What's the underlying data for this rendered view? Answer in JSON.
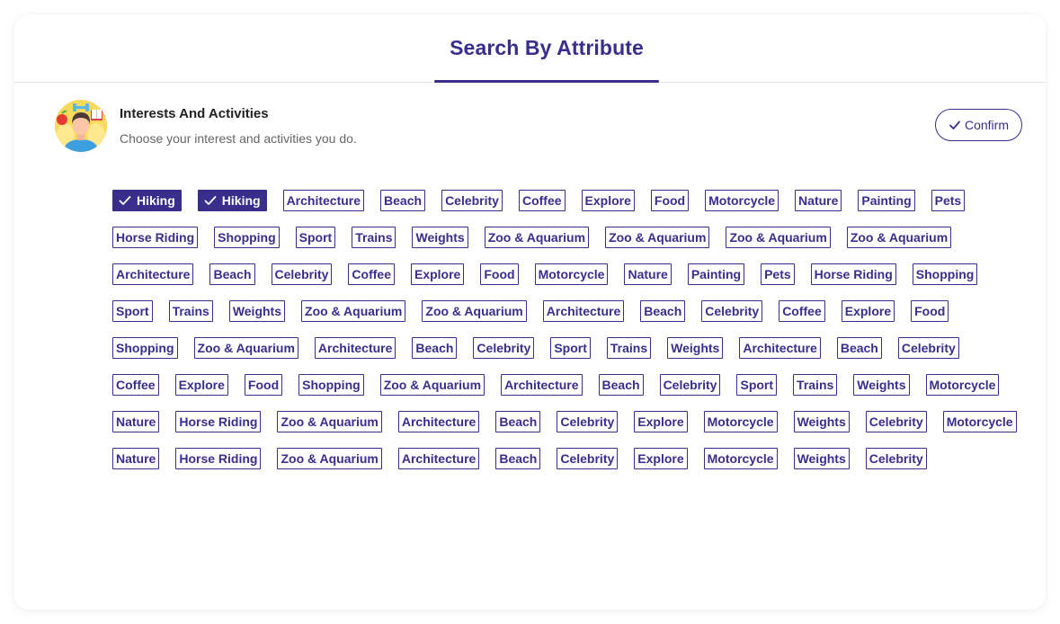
{
  "header": {
    "active_tab": "Search By Attribute"
  },
  "section": {
    "title": "Interests And Activities",
    "subtitle": "Choose your interest and activities you do.",
    "avatar_icon": "person-with-interests-icon",
    "confirm_label": "Confirm",
    "confirm_icon": "check-icon"
  },
  "colors": {
    "accent": "#3a2e8c",
    "text_dark": "#222222",
    "text_muted": "#666666",
    "divider": "#e3e3e8"
  },
  "chips": [
    {
      "label": "Hiking",
      "selected": true
    },
    {
      "label": "Hiking",
      "selected": true
    },
    {
      "label": "Architecture",
      "selected": false
    },
    {
      "label": "Beach",
      "selected": false
    },
    {
      "label": "Celebrity",
      "selected": false
    },
    {
      "label": "Coffee",
      "selected": false
    },
    {
      "label": "Explore",
      "selected": false
    },
    {
      "label": "Food",
      "selected": false
    },
    {
      "label": "Motorcycle",
      "selected": false
    },
    {
      "label": "Nature",
      "selected": false
    },
    {
      "label": "Painting",
      "selected": false
    },
    {
      "label": "Pets",
      "selected": false
    },
    {
      "label": "Horse Riding",
      "selected": false
    },
    {
      "label": "Shopping",
      "selected": false
    },
    {
      "label": "Sport",
      "selected": false
    },
    {
      "label": "Trains",
      "selected": false
    },
    {
      "label": "Weights",
      "selected": false
    },
    {
      "label": "Zoo & Aquarium",
      "selected": false
    },
    {
      "label": "Zoo & Aquarium",
      "selected": false
    },
    {
      "label": "Zoo & Aquarium",
      "selected": false
    },
    {
      "label": "Zoo & Aquarium",
      "selected": false
    },
    {
      "label": "Architecture",
      "selected": false
    },
    {
      "label": "Beach",
      "selected": false
    },
    {
      "label": "Celebrity",
      "selected": false
    },
    {
      "label": "Coffee",
      "selected": false
    },
    {
      "label": "Explore",
      "selected": false
    },
    {
      "label": "Food",
      "selected": false
    },
    {
      "label": "Motorcycle",
      "selected": false
    },
    {
      "label": "Nature",
      "selected": false
    },
    {
      "label": "Painting",
      "selected": false
    },
    {
      "label": "Pets",
      "selected": false
    },
    {
      "label": "Horse Riding",
      "selected": false
    },
    {
      "label": "Shopping",
      "selected": false
    },
    {
      "label": "Sport",
      "selected": false
    },
    {
      "label": "Trains",
      "selected": false
    },
    {
      "label": "Weights",
      "selected": false
    },
    {
      "label": "Zoo & Aquarium",
      "selected": false
    },
    {
      "label": "Zoo & Aquarium",
      "selected": false
    },
    {
      "label": "Architecture",
      "selected": false
    },
    {
      "label": "Beach",
      "selected": false
    },
    {
      "label": "Celebrity",
      "selected": false
    },
    {
      "label": "Coffee",
      "selected": false
    },
    {
      "label": "Explore",
      "selected": false
    },
    {
      "label": "Food",
      "selected": false
    },
    {
      "label": "Shopping",
      "selected": false
    },
    {
      "label": "Zoo & Aquarium",
      "selected": false
    },
    {
      "label": "Architecture",
      "selected": false
    },
    {
      "label": "Beach",
      "selected": false
    },
    {
      "label": "Celebrity",
      "selected": false
    },
    {
      "label": "Sport",
      "selected": false
    },
    {
      "label": "Trains",
      "selected": false
    },
    {
      "label": "Weights",
      "selected": false
    },
    {
      "label": "Architecture",
      "selected": false
    },
    {
      "label": "Beach",
      "selected": false
    },
    {
      "label": "Celebrity",
      "selected": false
    },
    {
      "label": "Coffee",
      "selected": false
    },
    {
      "label": "Explore",
      "selected": false
    },
    {
      "label": "Food",
      "selected": false
    },
    {
      "label": "Shopping",
      "selected": false
    },
    {
      "label": "Zoo & Aquarium",
      "selected": false
    },
    {
      "label": "Architecture",
      "selected": false
    },
    {
      "label": "Beach",
      "selected": false
    },
    {
      "label": "Celebrity",
      "selected": false
    },
    {
      "label": "Sport",
      "selected": false
    },
    {
      "label": "Trains",
      "selected": false
    },
    {
      "label": "Weights",
      "selected": false
    },
    {
      "label": "Motorcycle",
      "selected": false
    },
    {
      "label": "Nature",
      "selected": false
    },
    {
      "label": "Horse Riding",
      "selected": false
    },
    {
      "label": "Zoo & Aquarium",
      "selected": false
    },
    {
      "label": "Architecture",
      "selected": false
    },
    {
      "label": "Beach",
      "selected": false
    },
    {
      "label": "Celebrity",
      "selected": false
    },
    {
      "label": "Explore",
      "selected": false
    },
    {
      "label": "Motorcycle",
      "selected": false
    },
    {
      "label": "Weights",
      "selected": false
    },
    {
      "label": "Celebrity",
      "selected": false
    },
    {
      "label": "Motorcycle",
      "selected": false
    },
    {
      "label": "Nature",
      "selected": false
    },
    {
      "label": "Horse Riding",
      "selected": false
    },
    {
      "label": "Zoo & Aquarium",
      "selected": false
    },
    {
      "label": "Architecture",
      "selected": false
    },
    {
      "label": "Beach",
      "selected": false
    },
    {
      "label": "Celebrity",
      "selected": false
    },
    {
      "label": "Explore",
      "selected": false
    },
    {
      "label": "Motorcycle",
      "selected": false
    },
    {
      "label": "Weights",
      "selected": false
    },
    {
      "label": "Celebrity",
      "selected": false
    }
  ]
}
